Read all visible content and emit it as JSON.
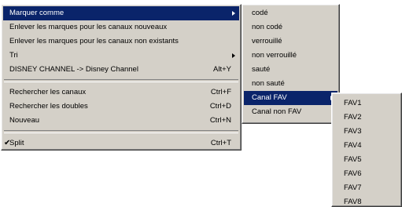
{
  "main_menu": {
    "group1": [
      {
        "label": "Marquer comme",
        "shortcut": "",
        "submenu": true,
        "selected": true
      },
      {
        "label": "Enlever les marques pour les canaux nouveaux",
        "shortcut": "",
        "submenu": false
      },
      {
        "label": "Enlever les marques pour les canaux non existants",
        "shortcut": "",
        "submenu": false
      },
      {
        "label": "Tri",
        "shortcut": "",
        "submenu": true
      },
      {
        "label": "DISNEY CHANNEL -> Disney Channel",
        "shortcut": "Alt+Y",
        "submenu": false
      }
    ],
    "group2": [
      {
        "label": "Rechercher les canaux",
        "shortcut": "Ctrl+F"
      },
      {
        "label": "Rechercher les doubles",
        "shortcut": "Ctrl+D"
      },
      {
        "label": "Nouveau",
        "shortcut": "Ctrl+N"
      }
    ],
    "group3": [
      {
        "label": "Split",
        "shortcut": "Ctrl+T",
        "checked": true,
        "check_glyph": "✔"
      }
    ]
  },
  "marquer_menu": {
    "items": [
      {
        "label": "codé"
      },
      {
        "label": "non codé"
      },
      {
        "label": "verrouillé"
      },
      {
        "label": "non verrouillé"
      },
      {
        "label": "sauté"
      },
      {
        "label": "non sauté"
      },
      {
        "label": "Canal FAV",
        "submenu": true,
        "selected": true
      },
      {
        "label": "Canal non FAV"
      }
    ]
  },
  "fav_menu": {
    "items": [
      "FAV1",
      "FAV2",
      "FAV3",
      "FAV4",
      "FAV5",
      "FAV6",
      "FAV7",
      "FAV8"
    ]
  },
  "colors": {
    "menu_bg": "#d4d0c8",
    "highlight": "#0a246a",
    "highlight_text": "#ffffff",
    "text": "#000000"
  },
  "icons": {
    "submenu_arrow": "submenu-arrow-icon",
    "checkmark": "checkmark-icon"
  }
}
